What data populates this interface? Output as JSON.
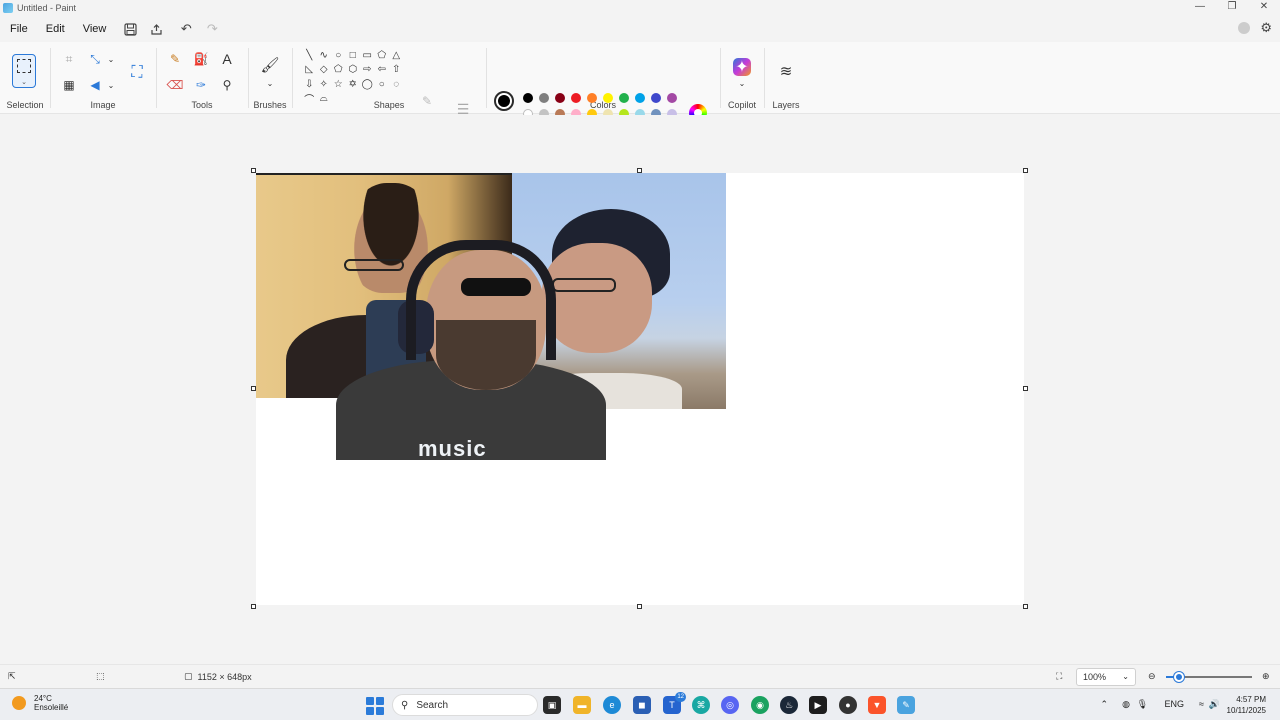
{
  "window": {
    "title": "Untitled - Paint",
    "minimize": "—",
    "restore": "❐",
    "close": "✕"
  },
  "menu": {
    "file": "File",
    "edit": "Edit",
    "view": "View"
  },
  "ribbon": {
    "groups": {
      "selection": "Selection",
      "image": "Image",
      "tools": "Tools",
      "brushes": "Brushes",
      "shapes": "Shapes",
      "colors": "Colors",
      "copilot": "Copilot",
      "layers": "Layers"
    },
    "text_tool_glyph": "A",
    "shapes": [
      "╲",
      "∿",
      "○",
      "□",
      "▭",
      "⬠",
      "△",
      "◺",
      "◇",
      "⬠",
      "⬡",
      "⇨",
      "⇦",
      "⇧",
      "⇩",
      "✧",
      "☆",
      "✡",
      "◯",
      "○",
      "◌",
      "⌒",
      "⌓"
    ],
    "colors_row1": [
      "#000000",
      "#7f7f7f",
      "#880015",
      "#ed1c24",
      "#ff7f27",
      "#fff200",
      "#22b14c",
      "#00a2e8",
      "#3f48cc",
      "#a349a4"
    ],
    "colors_row2": [
      "#ffffff",
      "#c3c3c3",
      "#b97a57",
      "#ffaec9",
      "#ffc90e",
      "#efe4b0",
      "#b5e61d",
      "#99d9ea",
      "#7092be",
      "#c8bfe7"
    ],
    "colors_row3_count": 10
  },
  "canvas": {
    "tshirt_text": "music"
  },
  "status": {
    "size": "1152 × 648px",
    "zoom": "100%",
    "zoom_fraction": 0.15
  },
  "taskbar": {
    "temperature": "24°C",
    "condition": "Ensoleillé",
    "search_placeholder": "Search",
    "teams_badge": "12",
    "language": "ENG",
    "time": "4:57 PM",
    "date": "10/11/2025"
  }
}
